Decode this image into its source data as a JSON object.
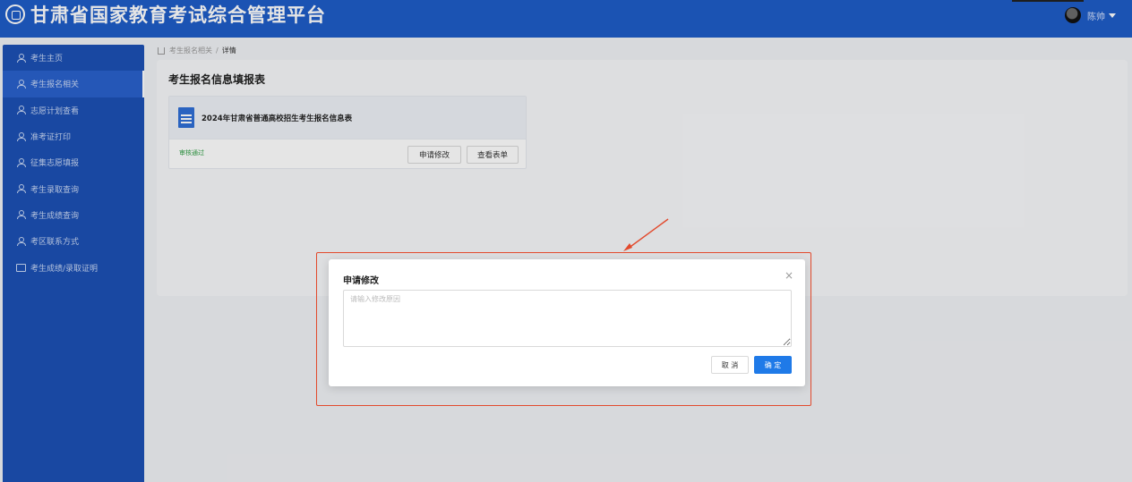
{
  "header": {
    "title": "甘肃省国家教育考试综合管理平台",
    "user_name": "陈帅"
  },
  "sidebar": {
    "items": [
      {
        "label": "考生主页",
        "icon": "person-icon"
      },
      {
        "label": "考生报名相关",
        "icon": "person-icon",
        "active": true
      },
      {
        "label": "志愿计划查看",
        "icon": "person-icon"
      },
      {
        "label": "准考证打印",
        "icon": "person-icon"
      },
      {
        "label": "征集志愿填报",
        "icon": "person-icon"
      },
      {
        "label": "考生录取查询",
        "icon": "person-icon"
      },
      {
        "label": "考生成绩查询",
        "icon": "person-icon"
      },
      {
        "label": "考区联系方式",
        "icon": "person-icon"
      },
      {
        "label": "考生成绩/录取证明",
        "icon": "card-icon"
      }
    ]
  },
  "breadcrumb": {
    "parent": "考生报名相关",
    "separator": "/",
    "current": "详情"
  },
  "main": {
    "title": "考生报名信息填报表",
    "form_card": {
      "name": "2024年甘肃省普通高校招生考生报名信息表",
      "status": "审核通过",
      "apply_button": "申请修改",
      "view_button": "查看表单"
    }
  },
  "modal": {
    "title": "申请修改",
    "placeholder": "请输入修改原因",
    "value": "",
    "cancel_label": "取 消",
    "ok_label": "确 定",
    "close_symbol": "×"
  },
  "colors": {
    "header_bg": "#1f5dc8",
    "sidebar_bg": "#1c51b5",
    "status_green": "#2f9e44",
    "primary_button": "#1f7ae8",
    "highlight_red": "#e24a2d"
  }
}
